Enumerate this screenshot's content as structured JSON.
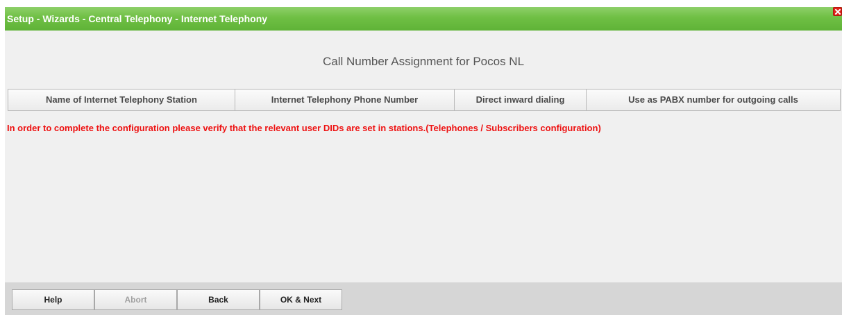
{
  "window": {
    "title": "Setup - Wizards - Central Telephony - Internet Telephony",
    "close_icon": "close-icon",
    "title_color": "#6fbf44",
    "close_color": "#e0241c"
  },
  "main": {
    "heading": "Call Number Assignment for Pocos NL",
    "table": {
      "columns": [
        "Name of Internet Telephony Station",
        "Internet Telephony Phone Number",
        "Direct inward dialing",
        "Use as PABX number for outgoing calls"
      ],
      "rows": []
    },
    "warning": "In order to complete the configuration please verify that the relevant user DIDs are set in stations.(Telephones / Subscribers configuration)",
    "warning_color": "#ee1111"
  },
  "footer": {
    "buttons": [
      {
        "label": "Help",
        "enabled": true
      },
      {
        "label": "Abort",
        "enabled": false
      },
      {
        "label": "Back",
        "enabled": true
      },
      {
        "label": "OK & Next",
        "enabled": true
      }
    ]
  }
}
